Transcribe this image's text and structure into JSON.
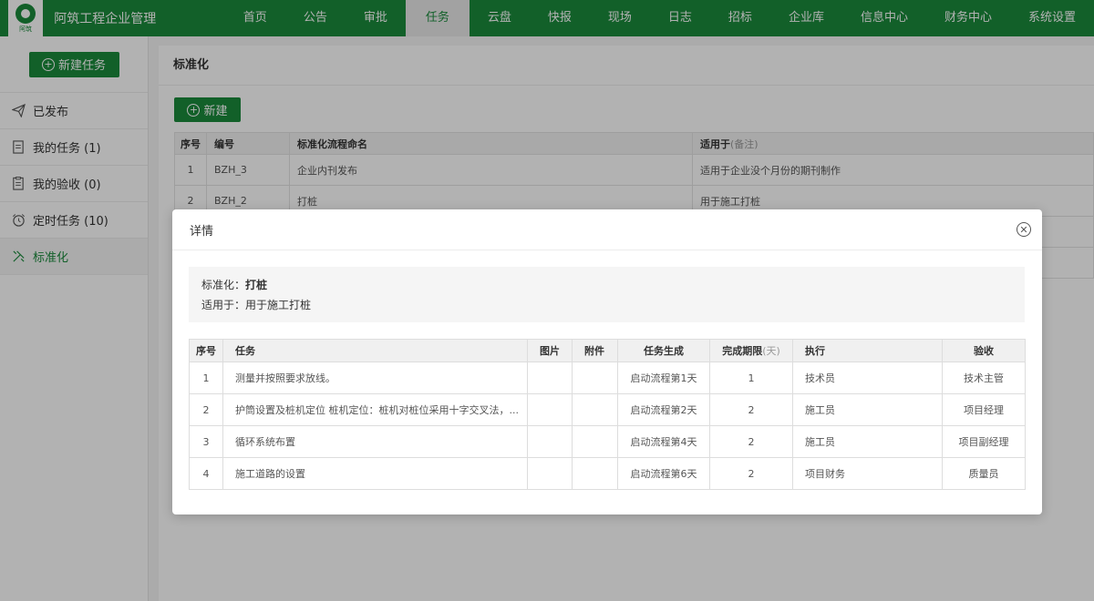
{
  "app": {
    "title": "阿筑工程企业管理",
    "logo_text": "阿筑"
  },
  "nav": [
    {
      "label": "首页"
    },
    {
      "label": "公告"
    },
    {
      "label": "审批"
    },
    {
      "label": "任务"
    },
    {
      "label": "云盘"
    },
    {
      "label": "快报"
    },
    {
      "label": "现场"
    },
    {
      "label": "日志"
    },
    {
      "label": "招标"
    },
    {
      "label": "企业库"
    },
    {
      "label": "信息中心"
    },
    {
      "label": "财务中心"
    },
    {
      "label": "系统设置"
    }
  ],
  "sidebar": {
    "new_task_label": "新建任务",
    "items": [
      {
        "label": "已发布",
        "icon": "send-icon"
      },
      {
        "label": "我的任务 (1)",
        "icon": "document-icon"
      },
      {
        "label": "我的验收 (0)",
        "icon": "checklist-icon"
      },
      {
        "label": "定时任务 (10)",
        "icon": "alarm-clock-icon"
      },
      {
        "label": "标准化",
        "icon": "tools-icon"
      }
    ]
  },
  "main": {
    "title": "标准化",
    "new_button": "新建",
    "table": {
      "headers": {
        "seq": "序号",
        "code": "编号",
        "name": "标准化流程命名",
        "apply": "适用于",
        "apply_hint": "(备注)"
      },
      "rows": [
        {
          "seq": "1",
          "code": "BZH_3",
          "name": "企业内刊发布",
          "apply": "适用于企业没个月份的期刊制作"
        },
        {
          "seq": "2",
          "code": "BZH_2",
          "name": "打桩",
          "apply": "用于施工打桩"
        }
      ]
    }
  },
  "modal": {
    "title": "详情",
    "info": {
      "standard_label": "标准化：",
      "standard_value": "打桩",
      "apply_label": "适用于：",
      "apply_value": "用于施工打桩"
    },
    "table": {
      "headers": {
        "seq": "序号",
        "task": "任务",
        "image": "图片",
        "attachment": "附件",
        "generate": "任务生成",
        "deadline": "完成期限",
        "deadline_unit": "(天)",
        "executor": "执行",
        "acceptance": "验收"
      },
      "rows": [
        {
          "seq": "1",
          "task": "测量并按照要求放线。",
          "image": "",
          "attachment": "",
          "generate": "启动流程第1天",
          "deadline": "1",
          "executor": "技术员",
          "acceptance": "技术主管"
        },
        {
          "seq": "2",
          "task": "护筒设置及桩机定位 桩机定位：桩机对桩位采用十字交叉法，...",
          "image": "",
          "attachment": "",
          "generate": "启动流程第2天",
          "deadline": "2",
          "executor": "施工员",
          "acceptance": "项目经理"
        },
        {
          "seq": "3",
          "task": "循环系统布置",
          "image": "",
          "attachment": "",
          "generate": "启动流程第4天",
          "deadline": "2",
          "executor": "施工员",
          "acceptance": "项目副经理"
        },
        {
          "seq": "4",
          "task": "施工道路的设置",
          "image": "",
          "attachment": "",
          "generate": "启动流程第6天",
          "deadline": "2",
          "executor": "项目财务",
          "acceptance": "质量员"
        }
      ]
    }
  },
  "colors": {
    "brand": "#1a8a3c"
  }
}
